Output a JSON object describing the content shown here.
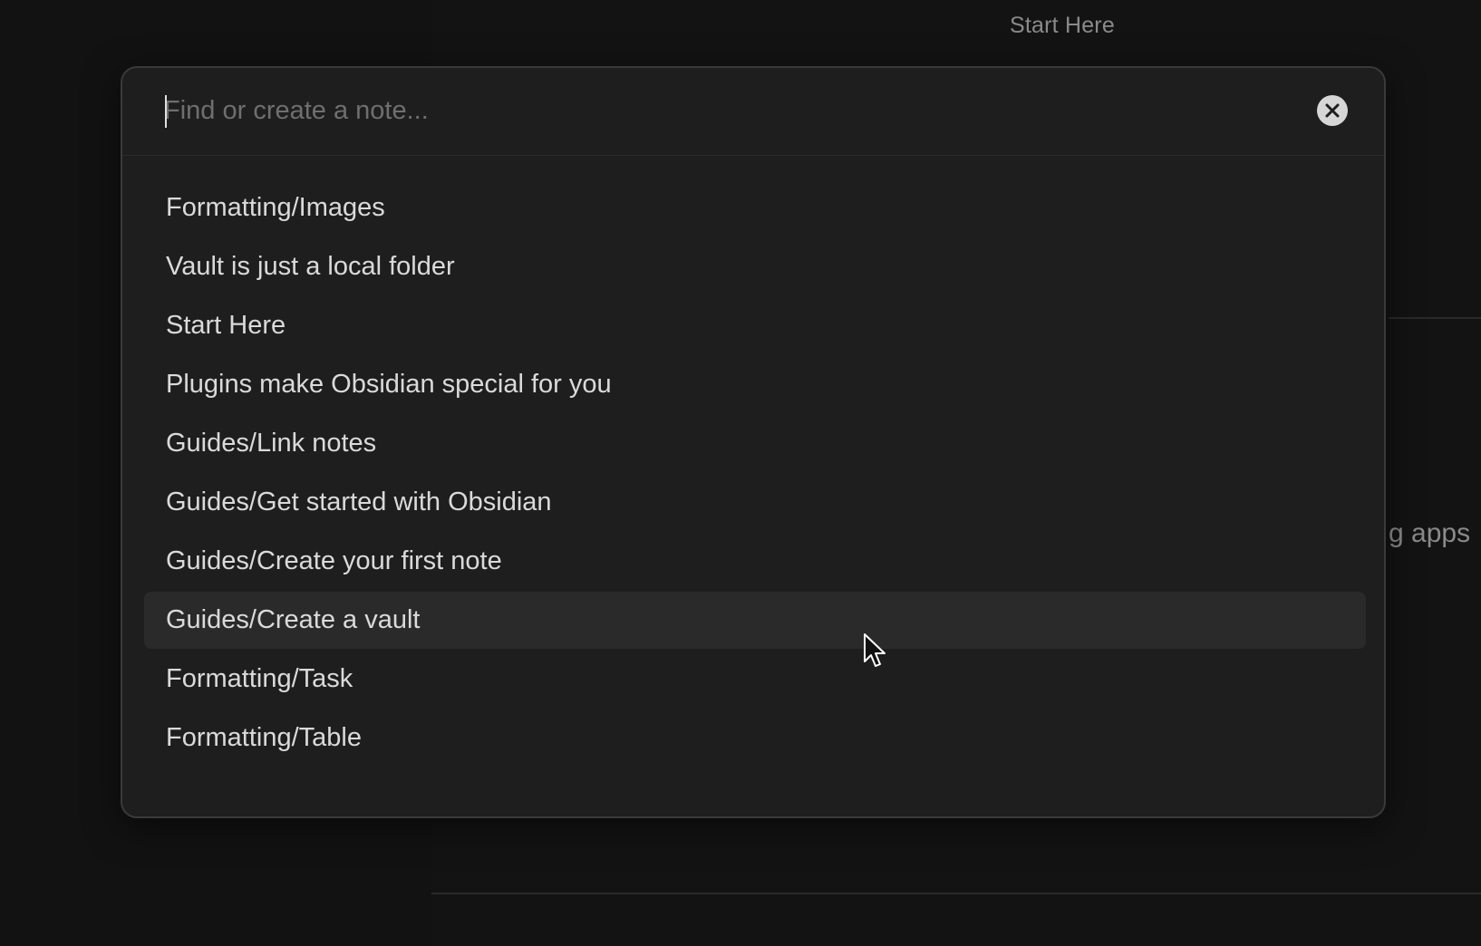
{
  "background": {
    "tab_title": "Start Here",
    "content_fragment": "g apps"
  },
  "quick_switcher": {
    "search": {
      "placeholder": "Find or create a note...",
      "value": ""
    },
    "clear_icon": "close-circle-icon",
    "results": [
      {
        "label": "Formatting/Images"
      },
      {
        "label": "Vault is just a local folder"
      },
      {
        "label": "Start Here"
      },
      {
        "label": "Plugins make Obsidian special for you"
      },
      {
        "label": "Guides/Link notes"
      },
      {
        "label": "Guides/Get started with Obsidian"
      },
      {
        "label": "Guides/Create your first note"
      },
      {
        "label": "Guides/Create a vault"
      },
      {
        "label": "Formatting/Task"
      },
      {
        "label": "Formatting/Table"
      }
    ],
    "selected_index": 7
  },
  "colors": {
    "modal_background": "#1e1e1e",
    "selected_row": "#2a2a2a",
    "text": "#dadada",
    "placeholder": "#6f6f6f"
  }
}
